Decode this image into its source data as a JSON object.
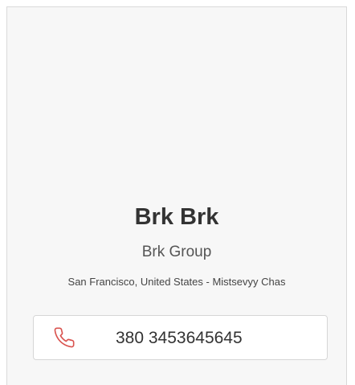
{
  "profile": {
    "name": "Brk Brk",
    "company": "Brk Group",
    "location": "San Francisco, United States - Mistsevyy Chas"
  },
  "contact": {
    "phone": "380 3453645645",
    "icon": "phone-icon",
    "icon_color": "#d9534f"
  }
}
